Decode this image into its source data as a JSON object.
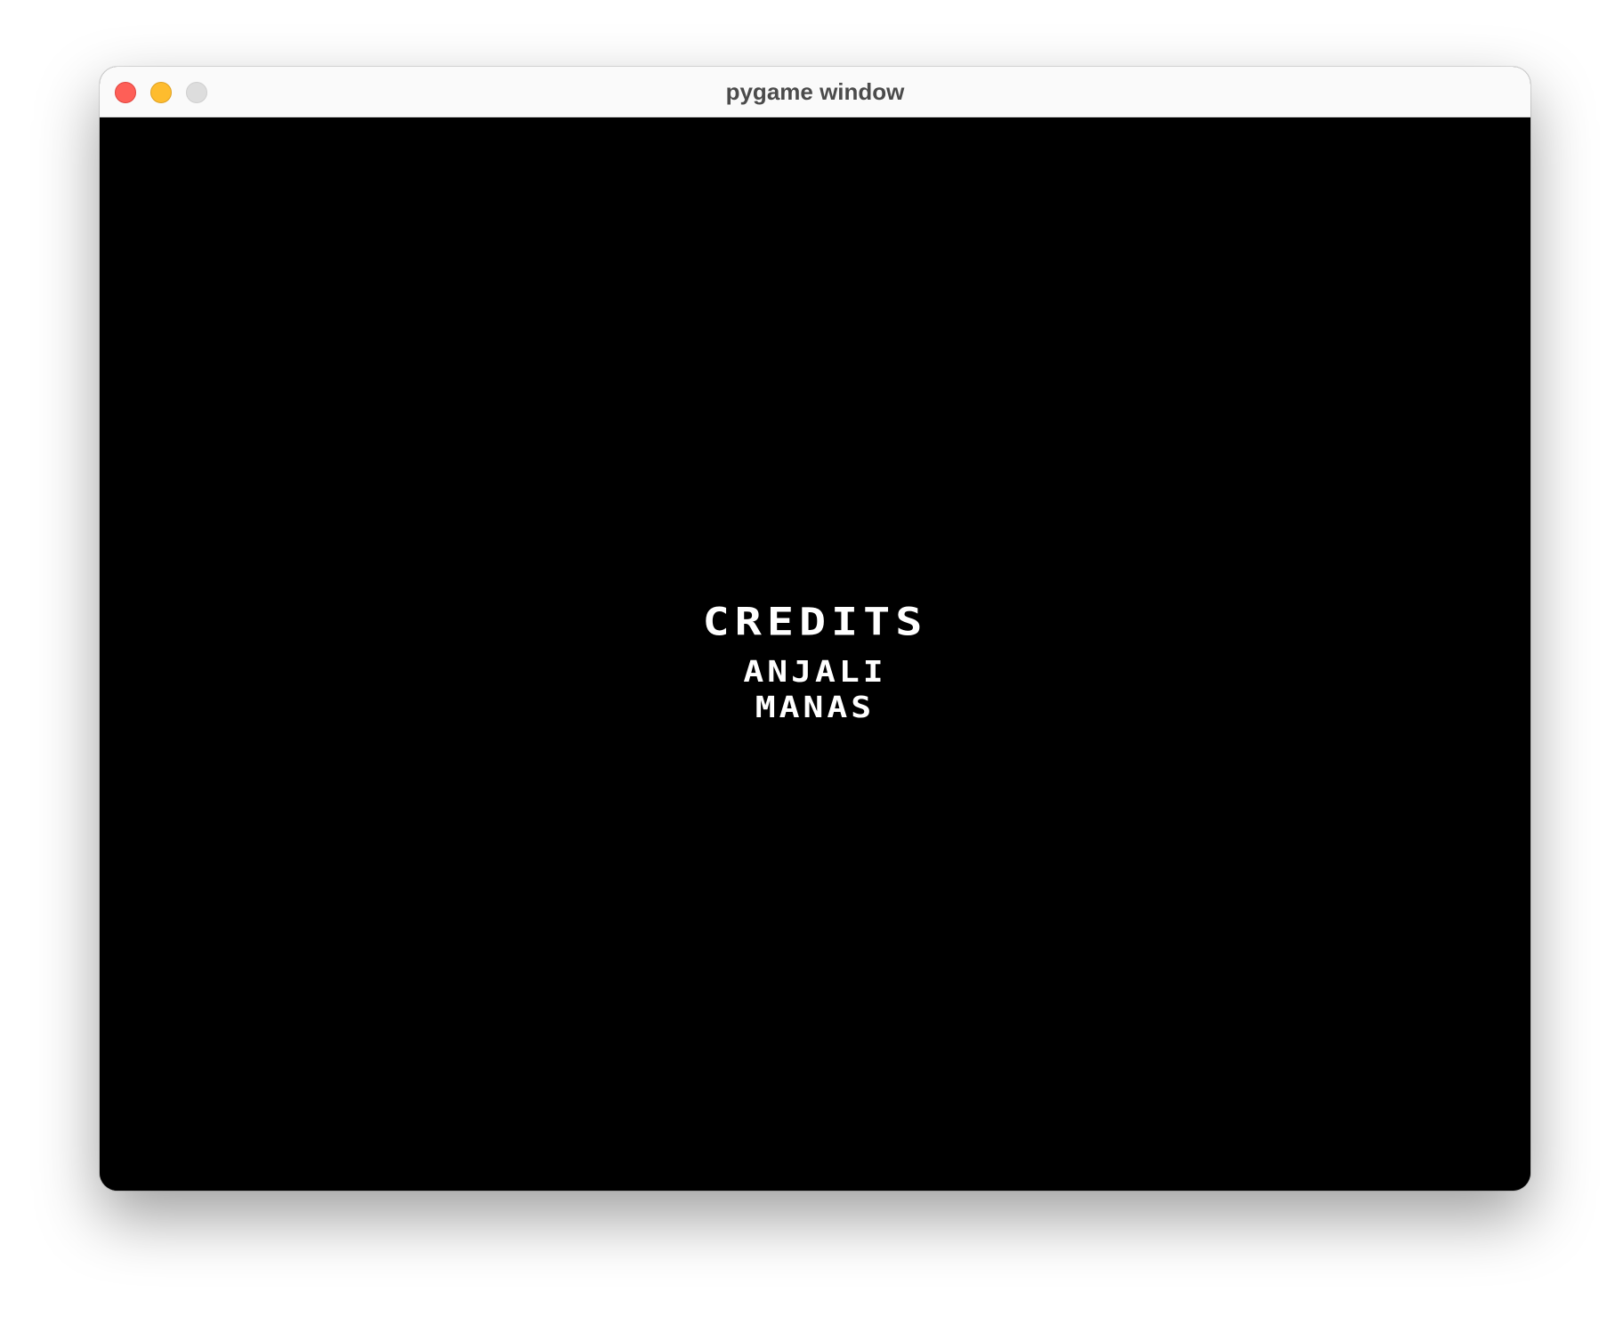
{
  "window": {
    "title": "pygame window"
  },
  "screen": {
    "heading": "CREDITS",
    "names": [
      "ANJALI",
      "MANAS"
    ]
  },
  "colors": {
    "background": "#000000",
    "text": "#ffffff",
    "titlebar": "#fafafa",
    "close": "#fe5f57",
    "minimize": "#febc2e",
    "zoom": "#dddddd"
  }
}
